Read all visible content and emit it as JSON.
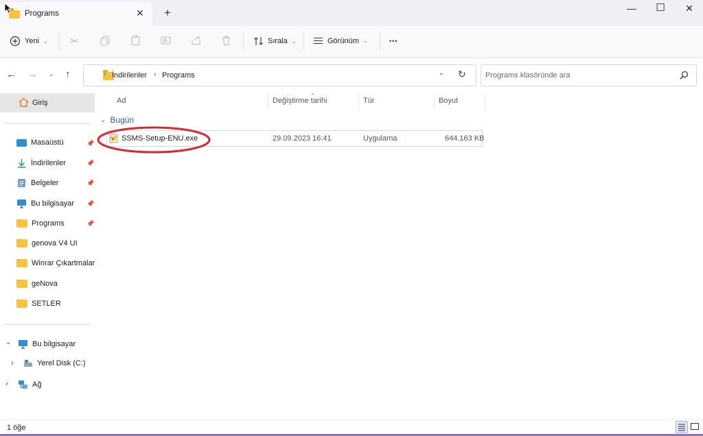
{
  "window": {
    "tab_title": "Programs",
    "tab_close": "✕",
    "tab_add": "+",
    "minimize": "—",
    "maximize": "☐",
    "close": "✕"
  },
  "toolbar": {
    "new_label": "Yeni",
    "sort_label": "Sırala",
    "view_label": "Görünüm",
    "more_label": "•••"
  },
  "address": {
    "crumbs": [
      "İndirilenler",
      "Programs"
    ],
    "search_placeholder": "Programs klasöründe ara"
  },
  "sidebar": {
    "home_label": "Giriş",
    "quick": [
      {
        "label": "Masaüstü",
        "icon": "desktop-icon",
        "pinned": true
      },
      {
        "label": "İndirilenler",
        "icon": "download-icon",
        "pinned": true
      },
      {
        "label": "Belgeler",
        "icon": "documents-icon",
        "pinned": true
      },
      {
        "label": "Bu bilgisayar",
        "icon": "computer-icon",
        "pinned": true
      },
      {
        "label": "Programs",
        "icon": "folder-icon",
        "pinned": true
      },
      {
        "label": "genova V4 UI",
        "icon": "folder-icon",
        "pinned": false
      },
      {
        "label": "Winrar Çıkartmalar",
        "icon": "folder-icon",
        "pinned": false
      },
      {
        "label": "geNova",
        "icon": "folder-icon",
        "pinned": false
      },
      {
        "label": "SETLER",
        "icon": "folder-icon",
        "pinned": false
      }
    ],
    "tree": [
      {
        "label": "Bu bilgisayar",
        "expanded": true
      },
      {
        "label": "Yerel Disk (C:)",
        "expanded": false
      },
      {
        "label": "Ağ",
        "expanded": false
      }
    ]
  },
  "content": {
    "columns": [
      "Ad",
      "Değiştirme tarihi",
      "Tür",
      "Boyut"
    ],
    "group_label": "Bugün",
    "files": [
      {
        "name": "SSMS-Setup-ENU.exe",
        "modified": "29.09.2023 16:41",
        "type": "Uygulama",
        "size": "644.163 KB"
      }
    ]
  },
  "status": {
    "count": "1 öğe"
  },
  "colors": {
    "highlight_ring": "#d9262f",
    "folder": "#f6c443",
    "accent": "#2a5ea8"
  }
}
